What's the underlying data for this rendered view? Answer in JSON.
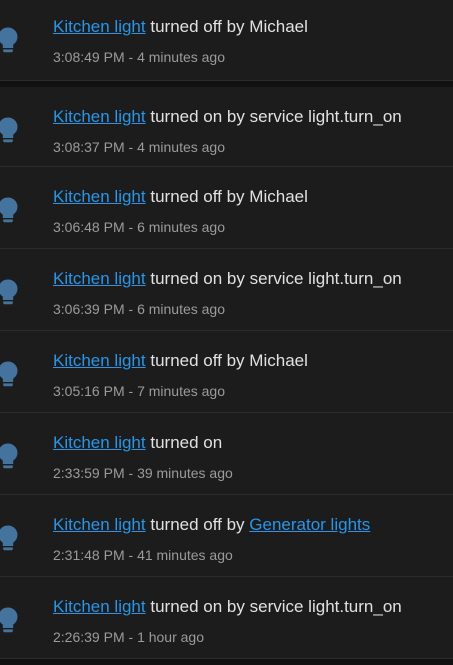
{
  "logbook": {
    "entries": [
      {
        "entity": "Kitchen light",
        "action": "turned off by",
        "actor": "Michael",
        "actor_link": false,
        "time": "3:08:49 PM",
        "ago": "4 minutes ago"
      },
      {
        "entity": "Kitchen light",
        "action": "turned on by",
        "actor": "service light.turn_on",
        "actor_link": false,
        "time": "3:08:37 PM",
        "ago": "4 minutes ago"
      },
      {
        "entity": "Kitchen light",
        "action": "turned off by",
        "actor": "Michael",
        "actor_link": false,
        "time": "3:06:48 PM",
        "ago": "6 minutes ago"
      },
      {
        "entity": "Kitchen light",
        "action": "turned on by",
        "actor": "service light.turn_on",
        "actor_link": false,
        "time": "3:06:39 PM",
        "ago": "6 minutes ago"
      },
      {
        "entity": "Kitchen light",
        "action": "turned off by",
        "actor": "Michael",
        "actor_link": false,
        "time": "3:05:16 PM",
        "ago": "7 minutes ago"
      },
      {
        "entity": "Kitchen light",
        "action": "turned on",
        "actor": "",
        "actor_link": false,
        "time": "2:33:59 PM",
        "ago": "39 minutes ago"
      },
      {
        "entity": "Kitchen light",
        "action": "turned off by",
        "actor": "Generator lights",
        "actor_link": true,
        "time": "2:31:48 PM",
        "ago": "41 minutes ago"
      },
      {
        "entity": "Kitchen light",
        "action": "turned on by",
        "actor": "service light.turn_on",
        "actor_link": false,
        "time": "2:26:39 PM",
        "ago": "1 hour ago"
      }
    ],
    "time_separator": " - ",
    "icon": "lightbulb-icon",
    "colors": {
      "background": "#111111",
      "row": "#1c1c1c",
      "divider": "#2c2c2c",
      "link": "#2596ea",
      "text": "#e1e1e1",
      "secondary": "#9b9b9b",
      "icon": "#44739e"
    }
  }
}
